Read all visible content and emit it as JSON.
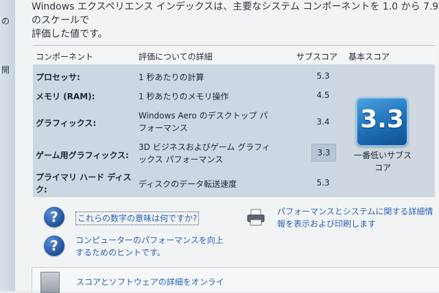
{
  "left_nav": {
    "stub_top": "の",
    "stub_mid": "開"
  },
  "intro": {
    "line1": "Windows エクスペリエンス インデックスは、主要なシステム コンポーネントを 1.0 から 7.9 のスケールで",
    "line2": "評価した値です。"
  },
  "table": {
    "headers": {
      "component": "コンポーネント",
      "details": "評価についての詳細",
      "subscore": "サブスコア",
      "basescore": "基本スコア"
    },
    "rows": [
      {
        "component": "プロセッサ:",
        "detail": [
          "1 秒あたりの計算"
        ],
        "subscore": "5.3"
      },
      {
        "component": "メモリ (RAM):",
        "detail": [
          "1 秒あたりのメモリ操作"
        ],
        "subscore": "4.5"
      },
      {
        "component": "グラフィックス:",
        "detail": [
          "Windows Aero のデスクトップ パ",
          "フォーマンス"
        ],
        "subscore": "3.4"
      },
      {
        "component": "ゲーム用グラフィックス:",
        "detail": [
          "3D ビジネスおよびゲーム グラフィ",
          "ックス パフォーマンス"
        ],
        "subscore": "3.3"
      },
      {
        "component": [
          "プライマリ ハード ディス",
          "ク:"
        ],
        "detail": [
          "ディスクのデータ転送速度"
        ],
        "subscore": "5.3"
      }
    ],
    "base": {
      "score": "3.3",
      "caption1": "一番低いサブス",
      "caption2": "コア"
    }
  },
  "links": {
    "meaning": "これらの数字の意味は何ですか?",
    "tips1": "コンピューターのパフォーマンスを向上",
    "tips2": "するためのヒントです。",
    "print1": "パフォーマンスとシステムに関する詳細情",
    "print2": "報を表示および印刷します"
  },
  "bottom": {
    "text": "スコアとソフトウェアの詳細をオンライ"
  },
  "colors": {
    "link": "#2a62b8",
    "badge": "#1d6fb8",
    "table_bg": "#cdd7e1"
  }
}
